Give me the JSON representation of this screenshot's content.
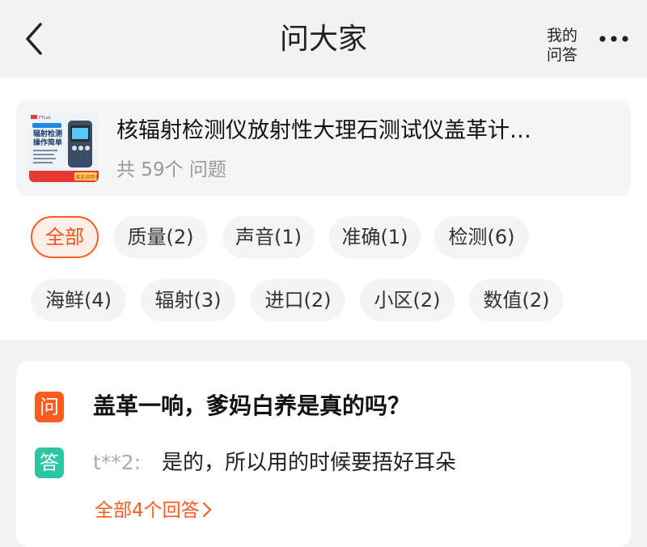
{
  "header": {
    "title": "问大家",
    "my_answers": [
      "我的",
      "问答"
    ]
  },
  "product": {
    "title": "核辐射检测仪放射性大理石测试仪盖革计…",
    "question_count": "共 59个 问题",
    "thumbnail": {
      "brand": "FTLab",
      "heading_line1": "辐射检测",
      "heading_line2": "操作简单",
      "footer_badge": "增送说明书"
    }
  },
  "tags": [
    {
      "label": "全部",
      "active": true
    },
    {
      "label": "质量(2)",
      "active": false
    },
    {
      "label": "声音(1)",
      "active": false
    },
    {
      "label": "准确(1)",
      "active": false
    },
    {
      "label": "检测(6)",
      "active": false
    },
    {
      "label": "海鲜(4)",
      "active": false
    },
    {
      "label": "辐射(3)",
      "active": false
    },
    {
      "label": "进口(2)",
      "active": false
    },
    {
      "label": "小区(2)",
      "active": false
    },
    {
      "label": "数值(2)",
      "active": false
    }
  ],
  "qa": {
    "question_badge": "问",
    "question": "盖革一响，爹妈白养是真的吗？",
    "answer_badge": "答",
    "answer_user": "t**2:",
    "answer_text": "是的，所以用的时候要捂好耳朵",
    "all_answers": "全部4个回答"
  },
  "colors": {
    "accent": "#ff5a1f",
    "answer_badge": "#2cc6a4",
    "background": "#f2f2f2",
    "card": "#ffffff"
  },
  "icons": {
    "back": "chevron-left-icon",
    "more": "more-dots-icon",
    "all_answers_arrow": "chevron-right-icon"
  }
}
